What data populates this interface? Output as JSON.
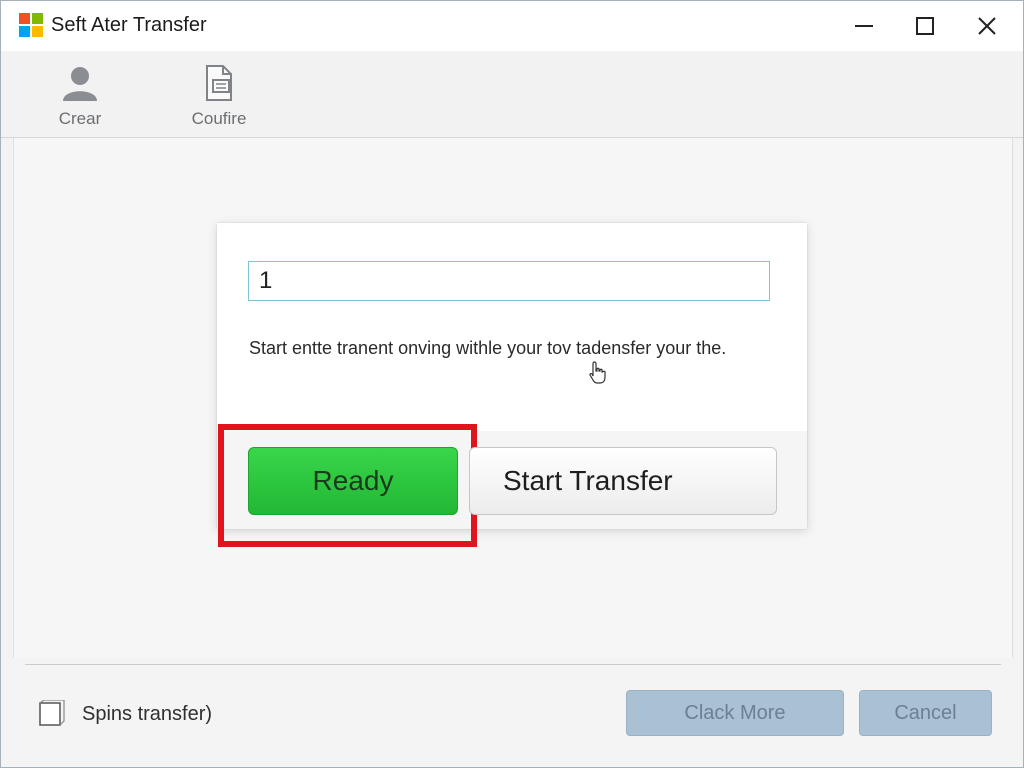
{
  "window": {
    "title": "Seft Ater Transfer"
  },
  "toolbar": {
    "items": [
      {
        "label": "Crear",
        "icon": "person-icon"
      },
      {
        "label": "Coufire",
        "icon": "document-config-icon"
      }
    ]
  },
  "dialog": {
    "input_value": "1",
    "description": "Start entte tranent onving withle your tov tadensfer your the.",
    "ready_label": "Ready",
    "start_label": "Start Transfer"
  },
  "footer": {
    "checkbox_label": "Spins transfer)",
    "more_label": "Clack More",
    "cancel_label": "Cancel"
  },
  "colors": {
    "ready_button": "#2cc63d",
    "highlight_box": "#e0141d",
    "disabled_button": "#a9c1d3",
    "input_border": "#7cc6d6"
  }
}
